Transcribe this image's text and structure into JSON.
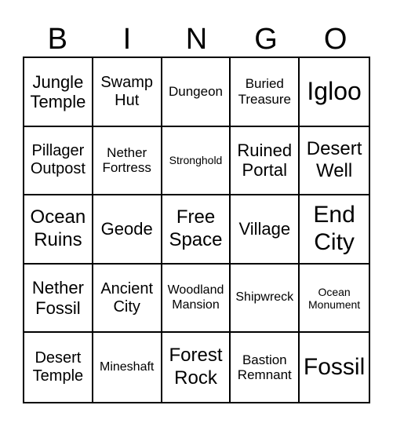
{
  "header": {
    "letters": [
      "B",
      "I",
      "N",
      "G",
      "O"
    ]
  },
  "cells": [
    "Jungle Temple",
    "Swamp Hut",
    "Dungeon",
    "Buried Treasure",
    "Igloo",
    "Pillager Outpost",
    "Nether Fortress",
    "Stronghold",
    "Ruined Portal",
    "Desert Well",
    "Ocean Ruins",
    "Geode",
    "Free Space",
    "Village",
    "End City",
    "Nether Fossil",
    "Ancient City",
    "Woodland Mansion",
    "Shipwreck",
    "Ocean Monument",
    "Desert Temple",
    "Mineshaft",
    "Forest Rock",
    "Bastion Remnant",
    "Fossil"
  ]
}
